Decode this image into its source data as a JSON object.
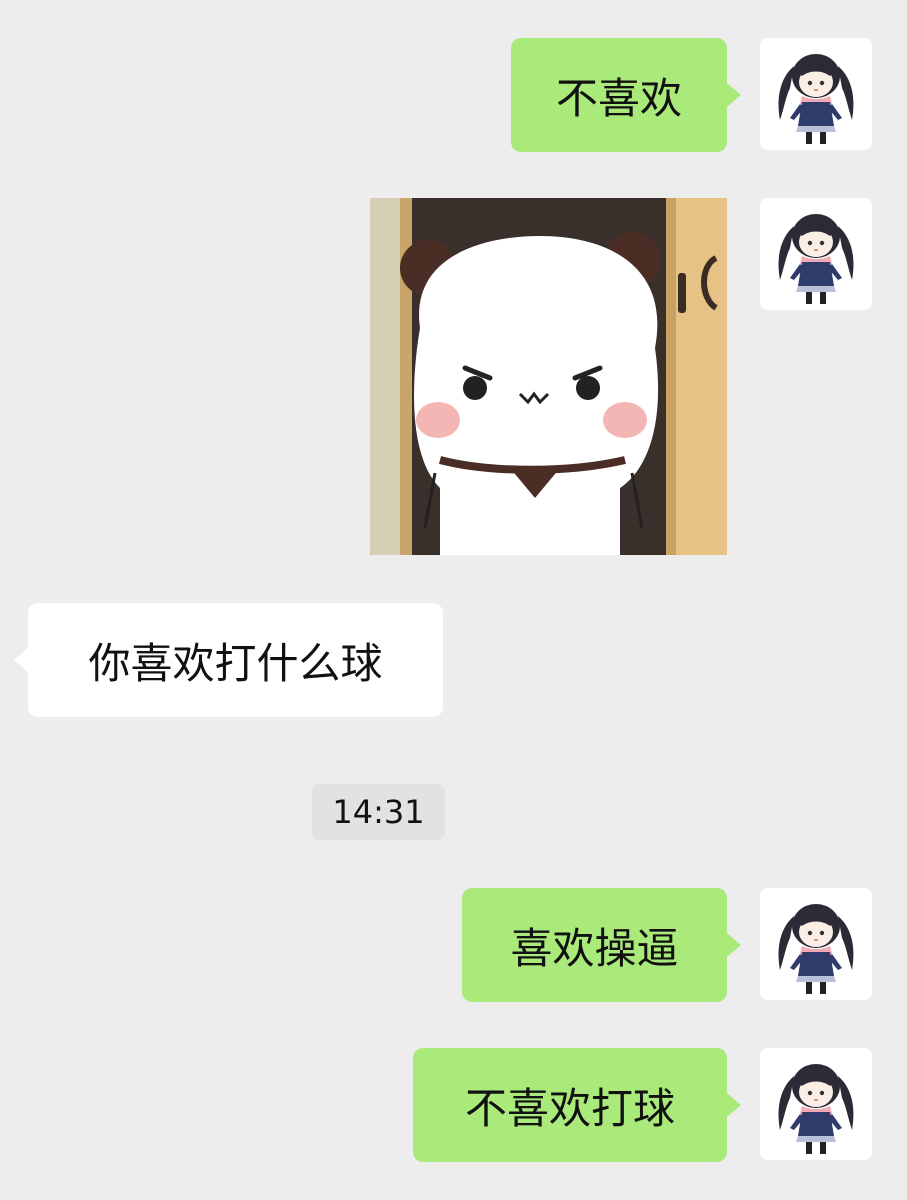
{
  "messages": [
    {
      "side": "out",
      "type": "text",
      "text": "不喜欢"
    },
    {
      "side": "out",
      "type": "sticker",
      "sticker": "angry-panda-peeking-door"
    },
    {
      "side": "in",
      "type": "text",
      "text": "你喜欢打什么球"
    },
    {
      "side": "out",
      "type": "text",
      "text": "喜欢操逼"
    },
    {
      "side": "out",
      "type": "text",
      "text": "不喜欢打球"
    }
  ],
  "timestamp": "14:31",
  "colors": {
    "background": "#ededed",
    "outgoing_bubble": "#a9ea7a",
    "incoming_bubble": "#ffffff",
    "timestamp_bg": "#e2e2e2"
  },
  "icons": {
    "avatar": "anime-girl-avatar"
  }
}
